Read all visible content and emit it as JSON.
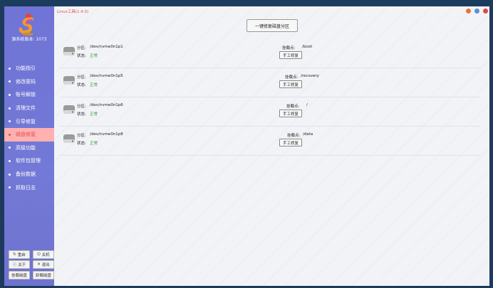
{
  "app": {
    "title": "Linux工具(1.4.0)"
  },
  "sidebar": {
    "version": "源系统版本: 1073",
    "items": [
      {
        "label": "功能指引"
      },
      {
        "label": "修改密码"
      },
      {
        "label": "账号解锁"
      },
      {
        "label": "清理文件"
      },
      {
        "label": "引导修复"
      },
      {
        "label": "磁盘修复",
        "active": true
      },
      {
        "label": "高级功能"
      },
      {
        "label": "软件包管理"
      },
      {
        "label": "备份数据"
      },
      {
        "label": "抓取日志"
      }
    ],
    "buttons": {
      "restart": "重启",
      "shutdown": "关机",
      "about": "关于",
      "exit": "退出",
      "mount": "挂载磁盘",
      "unmount": "卸载磁盘"
    }
  },
  "main": {
    "fix_all_button": "一键修复磁盘分区",
    "partition_label": "分区:",
    "status_label": "状态:",
    "mount_label": "挂载点:",
    "fix_button": "手工修复",
    "partitions": [
      {
        "device": "/dev/nvme0n1p1",
        "status": "正常",
        "mount": "/boot"
      },
      {
        "device": "/dev/nvme0n1p5",
        "status": "正常",
        "mount": "/recovery"
      },
      {
        "device": "/dev/nvme0n1p6",
        "status": "正常",
        "mount": "/"
      },
      {
        "device": "/dev/nvme0n1p8",
        "status": "正常",
        "mount": "/data"
      }
    ]
  },
  "colors": {
    "sidebar": "#7177d6",
    "active_item": "#ffb0b0",
    "status_ok": "#2a9d3a",
    "title": "#e05050"
  }
}
